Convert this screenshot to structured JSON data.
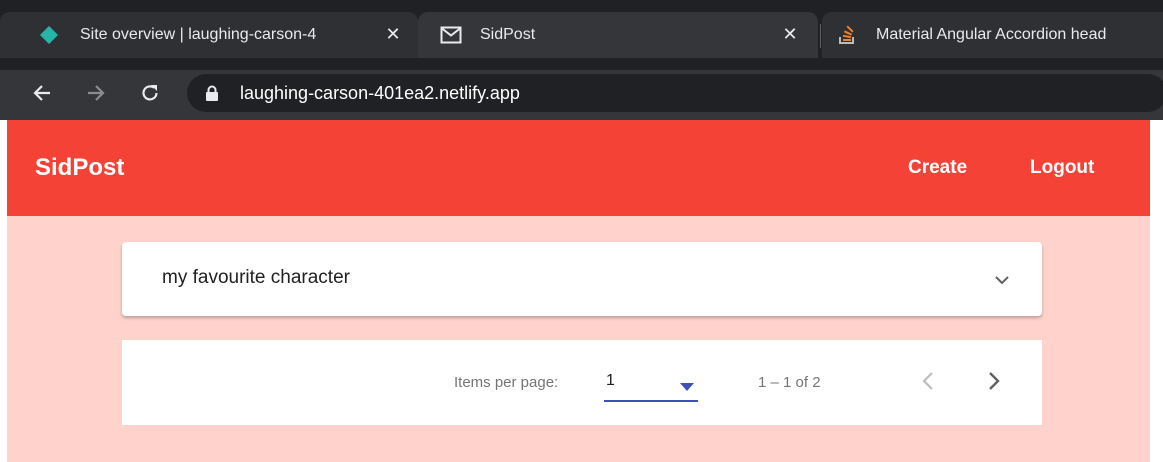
{
  "browser": {
    "tabs": [
      {
        "title": "Site overview | laughing-carson-4",
        "icon": "netlify-diamond-icon",
        "active": false
      },
      {
        "title": "SidPost",
        "icon": "mail-icon",
        "active": true
      },
      {
        "title": "Material Angular Accordion head",
        "icon": "stackoverflow-icon",
        "active": false
      }
    ],
    "close_glyph": "✕",
    "url": "laughing-carson-401ea2.netlify.app"
  },
  "app": {
    "brand": "SidPost",
    "nav": {
      "create": "Create",
      "logout": "Logout"
    },
    "panel": {
      "title": "my favourite character",
      "expanded": false
    },
    "paginator": {
      "items_label": "Items per page:",
      "page_size": "1",
      "range_label": "1 – 1 of 2",
      "prev_enabled": false,
      "next_enabled": true
    }
  },
  "colors": {
    "toolbar": "#f44336",
    "background": "#ffd2cc",
    "select_underline": "#3f51b5",
    "netlify_icon": "#26b5a9",
    "stackoverflow_icon": "#f48024"
  }
}
